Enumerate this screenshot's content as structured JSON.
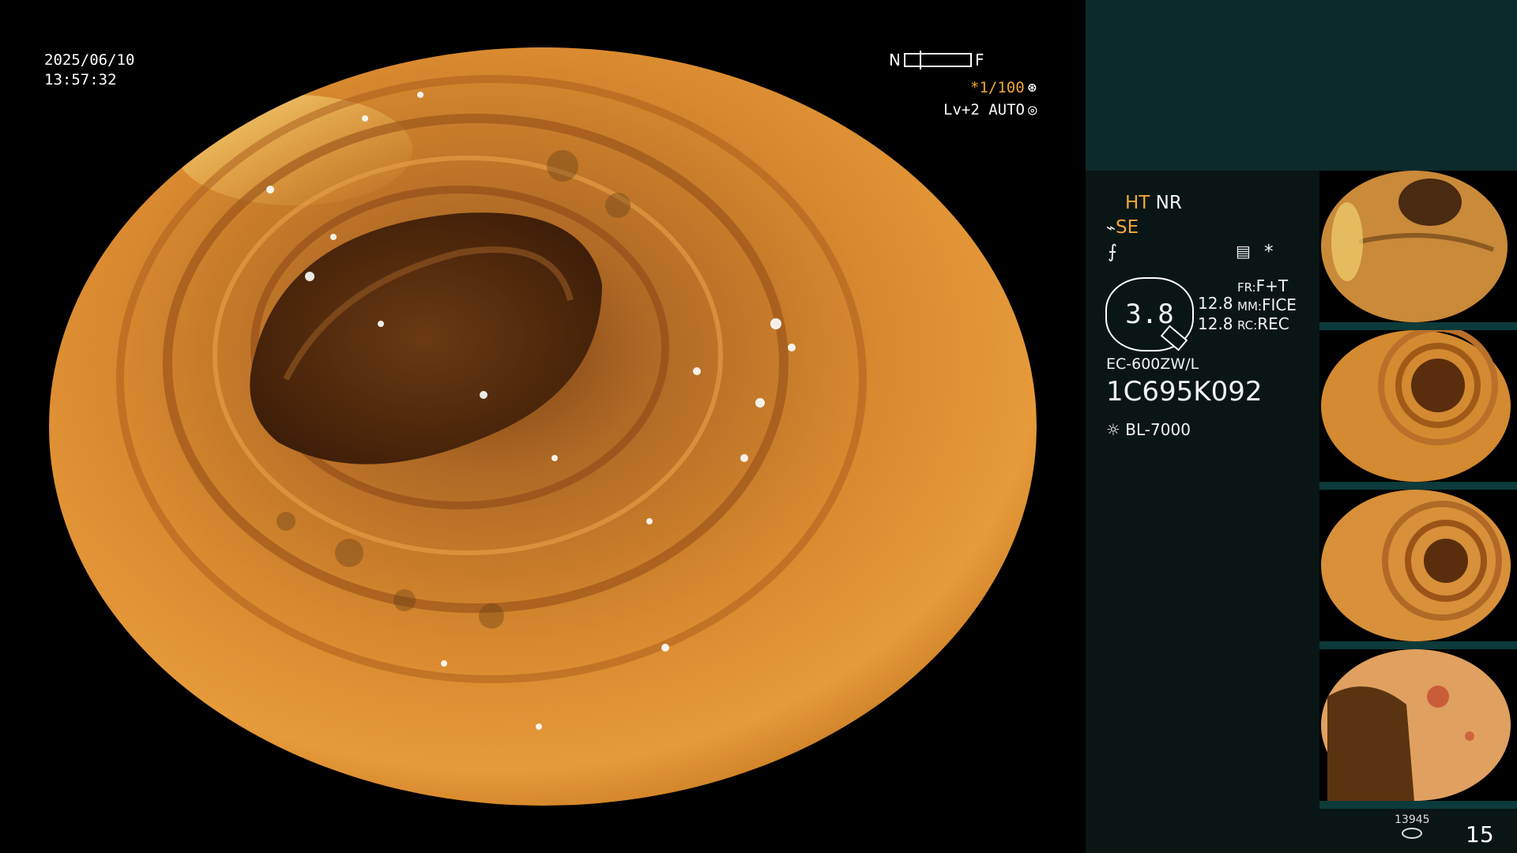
{
  "overlay": {
    "date": "2025/06/10",
    "time": "13:57:32",
    "near_label": "N",
    "far_label": "F",
    "shutter": "*1/100",
    "shutter_icon": "aperture-icon",
    "level": "Lv+2 AUTO",
    "level_icon": "iris-icon"
  },
  "panel": {
    "ht": "HT",
    "nr": "NR",
    "se": "SE",
    "se_icon": "structure-enhance-icon",
    "freeze_icon": "freeze-icon",
    "filter_icon": "filter-icon",
    "asterisk": "*",
    "dial_value": "3.8",
    "v1": "12.8",
    "v2": "12.8",
    "fr_label": "FR:",
    "fr_value": "F+T",
    "mm_label": "MM:",
    "mm_value": "FICE",
    "rc_label": "RC:",
    "rc_value": "REC",
    "scope_model": "EC-600ZW/L",
    "serial": "1C695K092",
    "light_source": "BL-7000",
    "light_icon": "lamp-icon"
  },
  "thumbnails": [
    {
      "label": "capture-1"
    },
    {
      "label": "capture-2"
    },
    {
      "label": "capture-3"
    },
    {
      "label": "capture-4"
    }
  ],
  "footer": {
    "count": "13945",
    "storage_icon": "storage-icon",
    "index": "15"
  },
  "colors": {
    "accent_orange": "#f0a73a",
    "panel_bg": "#0a1616",
    "panel_top_bg": "#0d2a2a"
  }
}
